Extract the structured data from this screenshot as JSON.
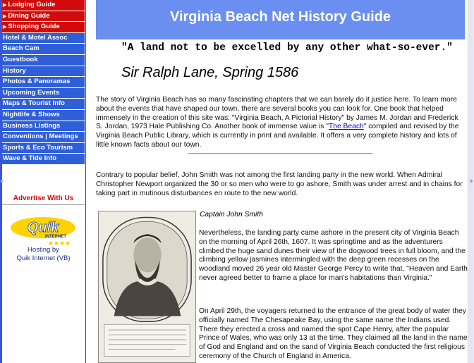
{
  "sidebar": {
    "items": [
      {
        "label": "Lodging Guide",
        "style": "red",
        "arrow": true
      },
      {
        "label": "Dining Guide",
        "style": "red",
        "arrow": true
      },
      {
        "label": "Shopping Guide",
        "style": "red",
        "arrow": true
      },
      {
        "label": "Hotel & Motel Assoc",
        "style": "blue",
        "arrow": false
      },
      {
        "label": "Beach Cam",
        "style": "blue",
        "arrow": false
      },
      {
        "label": "Guestbook",
        "style": "blue",
        "arrow": false
      },
      {
        "label": "History",
        "style": "blue",
        "arrow": false
      },
      {
        "label": "Photos & Panoramas",
        "style": "blue",
        "arrow": false
      },
      {
        "label": "Upcoming Events",
        "style": "blue",
        "arrow": false
      },
      {
        "label": "Maps & Tourist Info",
        "style": "blue",
        "arrow": false
      },
      {
        "label": "Nightlife & Shows",
        "style": "blue",
        "arrow": false
      },
      {
        "label": "Business Listings",
        "style": "blue",
        "arrow": false
      },
      {
        "label": "Conventions | Meetings",
        "style": "blue",
        "arrow": false
      },
      {
        "label": "Sports & Eco Tourism",
        "style": "blue",
        "arrow": false
      },
      {
        "label": "Wave & Tide Info",
        "style": "blue",
        "arrow": false
      }
    ],
    "arrow_glyph": "▶",
    "advertise": "Advertise With Us",
    "logo_text": "Quik",
    "logo_subtext": "INTERNET",
    "hosted_line1": "Hosting by",
    "hosted_line2": "Quik Internet (VB)"
  },
  "header": {
    "title": "Virginia Beach Net History Guide"
  },
  "quote": "\"A land not to be excelled by any other what-so-ever.\"",
  "author": "Sir Ralph Lane, Spring 1586",
  "para1_pre": "The story of Virginia Beach has so many fascinating chapters that we can barely do it justice here. To learn more about the events that have shaped our town, there are several books you can look for. One book that helped immensely in the creation of this site was: \"Virginia Beach, A Pictorial History\" by James M. Jordan and Frederick S. Jordan, 1973 Hale Publishing Co. Another book of immense value is \"",
  "para1_link": "The Beach",
  "para1_post": "\" compiled and revised by the Virginia Beach Public Library, which is currently in print and available. It offers a very complete history and lots of little known facts about our town.",
  "para2": "Contrary to popular belief, John Smith was not among the first landing party in the new world. When Admiral Christopher Newport organized the 30 or so men who were to go ashore, Smith was under arrest and in chains for taking part in mutinous disturbances en route to the new world.",
  "caption": "Captain John Smith",
  "para3": "Nevertheless, the landing party came ashore in the present city of Virginia Beach on the morning of April 26th, 1607. It was springtime and as the adventurers climbed the huge sand dunes their view of the dogwood trees in full bloom, and the climbing yellow jasmines intermingled with the deep green recesses on the woodland moved 26 year old Master George Percy to write that, \"Heaven and Earth never agreed better to frame a place for man's habitations than Virginia.\"",
  "para4": "On April 29th, the voyagers returned to the entrance of the great body of water they officially named The Chesapeake Bay, using the same name the Indians used. There they erected a cross and named the spot Cape Henry, after the popular Prince of Wales, who was only 13 at the time. They claimed all the land in the name of God and England and on the sand of Virginia Beach conducted the first religious ceremony of the Church of England in America.",
  "colors": {
    "nav_red": "#d10a0a",
    "nav_blue": "#2f5fd8",
    "header_bg": "#6b8ff0",
    "link": "#0000cc"
  }
}
